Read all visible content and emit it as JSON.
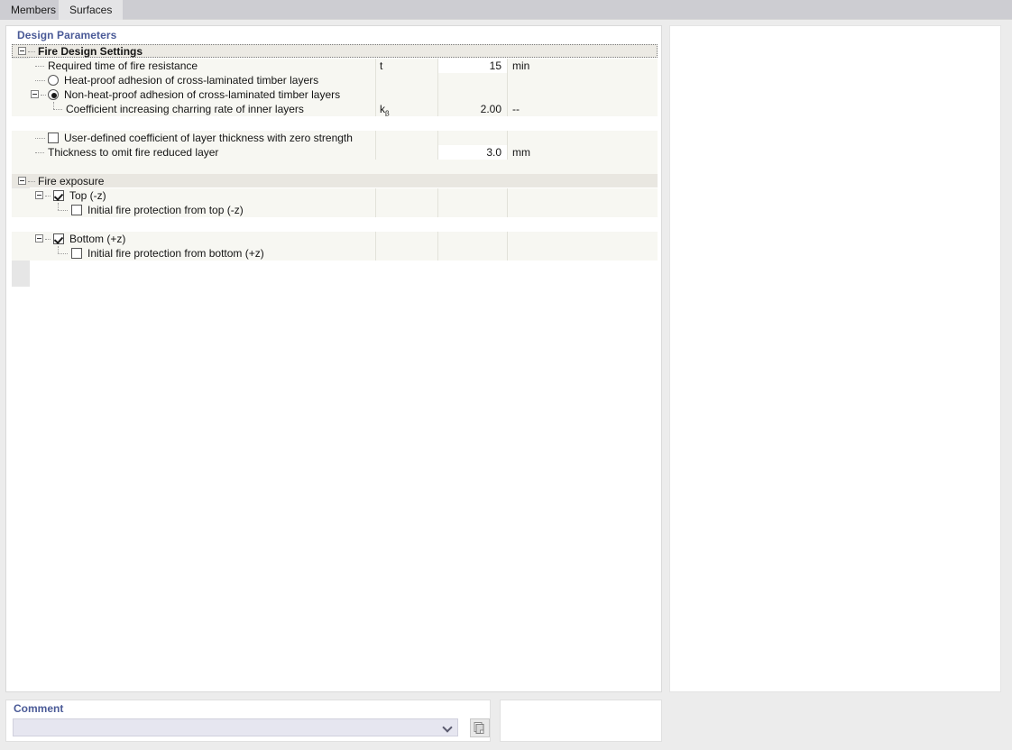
{
  "tabs": [
    {
      "id": "members",
      "label": "Members",
      "active": false
    },
    {
      "id": "surfaces",
      "label": "Surfaces",
      "active": true
    }
  ],
  "left_panel": {
    "title": "Design Parameters",
    "groups": [
      {
        "id": "fire-design-settings",
        "label": "Fire Design Settings",
        "focused": true,
        "rows": [
          {
            "id": "required-time-of-fire-resistance",
            "label": "Required time of fire resistance",
            "symbol": "t",
            "value": "15",
            "unit": "min",
            "editable": true,
            "control": "none"
          },
          {
            "id": "heat-proof-adhesion",
            "label": "Heat-proof adhesion of cross-laminated timber layers",
            "symbol": "",
            "value": "",
            "unit": "",
            "editable": false,
            "control": "radio",
            "selected": false
          },
          {
            "id": "non-heat-proof-adhesion",
            "label": "Non-heat-proof adhesion of cross-laminated timber layers",
            "symbol": "",
            "value": "",
            "unit": "",
            "editable": false,
            "control": "radio",
            "selected": true
          },
          {
            "id": "coefficient-increasing-charring-rate",
            "label": "Coefficient increasing charring rate of inner layers",
            "symbol": "k",
            "symbol_sub": "β",
            "value": "2.00",
            "unit": "--",
            "editable": false,
            "control": "none"
          },
          {
            "id": "spacer-row-1",
            "label": "",
            "symbol": "",
            "value": "",
            "unit": "",
            "blank": true,
            "control": "none"
          },
          {
            "id": "user-defined-coefficient-zero-strength",
            "label": "User-defined coefficient of layer thickness with zero strength",
            "symbol": "",
            "value": "",
            "unit": "",
            "editable": false,
            "control": "checkbox",
            "checked": false
          },
          {
            "id": "thickness-to-omit-fire-reduced-layer",
            "label": "Thickness to omit fire reduced layer",
            "symbol": "",
            "value": "3.0",
            "unit": "mm",
            "editable": true,
            "control": "none"
          }
        ]
      },
      {
        "id": "fire-exposure",
        "label": "Fire exposure",
        "focused": false,
        "rows": [
          {
            "id": "top-minus-z",
            "label": "Top (-z)",
            "symbol": "",
            "value": "",
            "unit": "",
            "control": "checkbox",
            "checked": true
          },
          {
            "id": "initial-fire-protection-from-top",
            "label": "Initial fire protection from top (-z)",
            "symbol": "",
            "value": "",
            "unit": "",
            "control": "checkbox",
            "checked": false
          },
          {
            "id": "spacer-row-2",
            "label": "",
            "symbol": "",
            "value": "",
            "unit": "",
            "blank": true,
            "control": "none"
          },
          {
            "id": "bottom-plus-z",
            "label": "Bottom (+z)",
            "symbol": "",
            "value": "",
            "unit": "",
            "control": "checkbox",
            "checked": true
          },
          {
            "id": "initial-fire-protection-from-bottom",
            "label": "Initial fire protection from bottom (+z)",
            "symbol": "",
            "value": "",
            "unit": "",
            "control": "checkbox",
            "checked": false
          }
        ]
      }
    ]
  },
  "comment": {
    "title": "Comment",
    "value": "",
    "placeholder": "",
    "copy_icon": "copy-pages-icon",
    "chevron_icon": "chevron-down-icon"
  },
  "colors": {
    "accent_title": "#4a5a97",
    "row_bg": "#f7f7f2",
    "row_bg_white": "#ffffff",
    "group_header_bg": "#eceae4",
    "tab_inactive": "#cdcdd2",
    "tab_active": "#e4e4e6",
    "window_bg": "#ececec"
  }
}
